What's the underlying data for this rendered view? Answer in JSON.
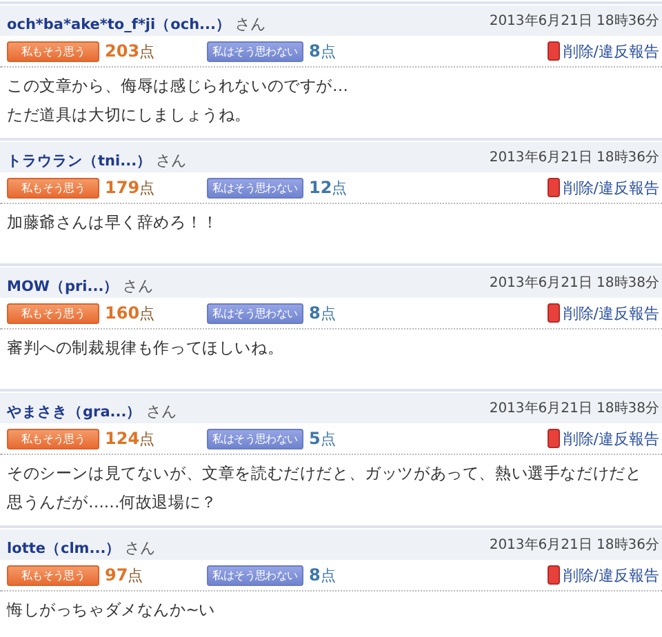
{
  "comments": [
    {
      "name": "och*ba*ake*to_f*ji（och...）",
      "suffix": "さん",
      "date": "2013年6月21日 18時36分",
      "agree_label": "私もそう思う",
      "agree_points": "203",
      "agree_unit": "点",
      "disagree_label": "私はそう思わない",
      "disagree_points": "8",
      "disagree_unit": "点",
      "report": "削除/違反報告",
      "body": [
        "この文章から、侮辱は感じられないのですが…",
        "ただ道具は大切にしましょうね。"
      ]
    },
    {
      "name": "トラウラン（tni...）",
      "suffix": "さん",
      "date": "2013年6月21日 18時36分",
      "agree_label": "私もそう思う",
      "agree_points": "179",
      "agree_unit": "点",
      "disagree_label": "私はそう思わない",
      "disagree_points": "12",
      "disagree_unit": "点",
      "report": "削除/違反報告",
      "body": [
        "加藤爺さんは早く辞めろ！！"
      ]
    },
    {
      "name": "MOW（pri...）",
      "suffix": "さん",
      "date": "2013年6月21日 18時38分",
      "agree_label": "私もそう思う",
      "agree_points": "160",
      "agree_unit": "点",
      "disagree_label": "私はそう思わない",
      "disagree_points": "8",
      "disagree_unit": "点",
      "report": "削除/違反報告",
      "body": [
        "審判への制裁規律も作ってほしいね。"
      ]
    },
    {
      "name": "やまさき（gra...）",
      "suffix": "さん",
      "date": "2013年6月21日 18時38分",
      "agree_label": "私もそう思う",
      "agree_points": "124",
      "agree_unit": "点",
      "disagree_label": "私はそう思わない",
      "disagree_points": "5",
      "disagree_unit": "点",
      "report": "削除/違反報告",
      "body": [
        "そのシーンは見てないが、文章を読むだけだと、ガッツがあって、熱い選手なだけだと",
        "思うんだが……何故退場に？"
      ]
    },
    {
      "name": "lotte（clm...）",
      "suffix": "さん",
      "date": "2013年6月21日 18時36分",
      "agree_label": "私もそう思う",
      "agree_points": "97",
      "agree_unit": "点",
      "disagree_label": "私はそう思わない",
      "disagree_points": "8",
      "disagree_unit": "点",
      "report": "削除/違反報告",
      "body": [
        "悔しがっちゃダメなんか~い"
      ]
    }
  ]
}
